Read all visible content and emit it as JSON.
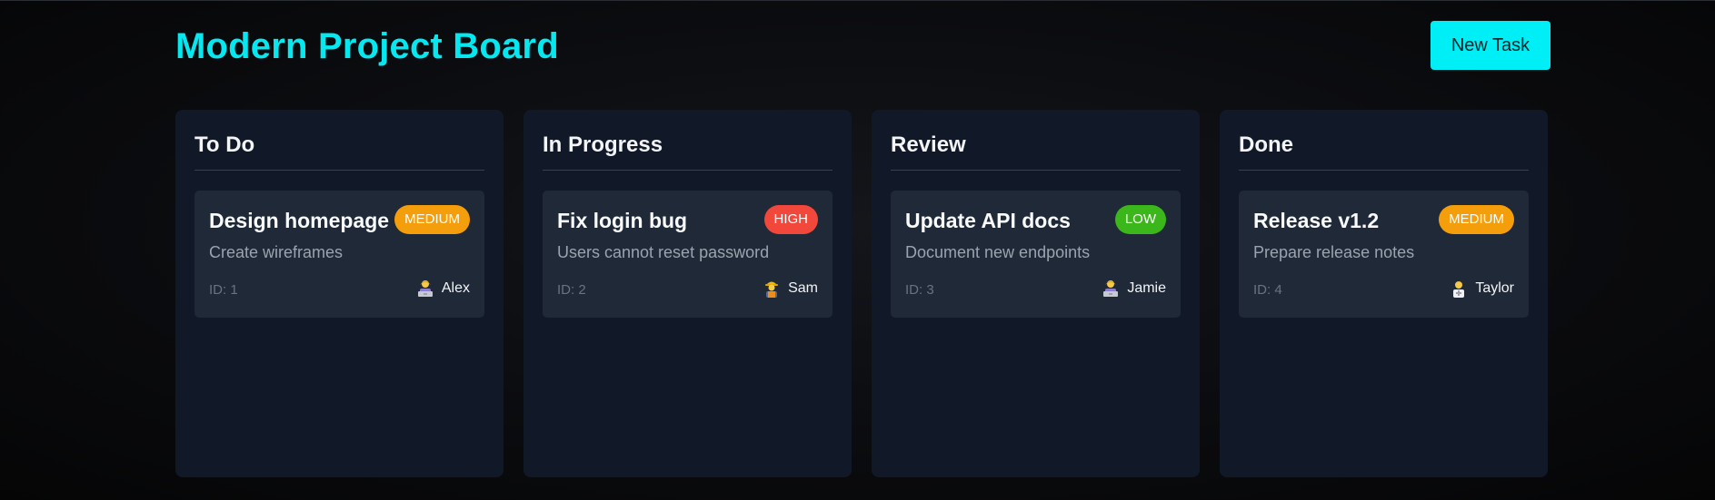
{
  "header": {
    "title": "Modern Project Board",
    "new_task_label": "New Task"
  },
  "colors": {
    "accent": "#06e8f0",
    "column_bg": "#111827",
    "card_bg": "#1f2937",
    "priority_high": "#f2473b",
    "priority_medium": "#f59e0b",
    "priority_low": "#3bb71b"
  },
  "columns": [
    {
      "title": "To Do",
      "cards": [
        {
          "title": "Design homepage",
          "priority": "MEDIUM",
          "priority_color": "#f59e0b",
          "description": "Create wireframes",
          "id_label": "ID: 1",
          "assignee": "Alex",
          "avatar_icon": "person-at-computer-icon"
        }
      ]
    },
    {
      "title": "In Progress",
      "cards": [
        {
          "title": "Fix login bug",
          "priority": "HIGH",
          "priority_color": "#f2473b",
          "description": "Users cannot reset password",
          "id_label": "ID: 2",
          "assignee": "Sam",
          "avatar_icon": "construction-worker-icon"
        }
      ]
    },
    {
      "title": "Review",
      "cards": [
        {
          "title": "Update API docs",
          "priority": "LOW",
          "priority_color": "#3bb71b",
          "description": "Document new endpoints",
          "id_label": "ID: 3",
          "assignee": "Jamie",
          "avatar_icon": "person-at-computer-icon"
        }
      ]
    },
    {
      "title": "Done",
      "cards": [
        {
          "title": "Release v1.2",
          "priority": "MEDIUM",
          "priority_color": "#f59e0b",
          "description": "Prepare release notes",
          "id_label": "ID: 4",
          "assignee": "Taylor",
          "avatar_icon": "health-worker-icon"
        }
      ]
    }
  ]
}
